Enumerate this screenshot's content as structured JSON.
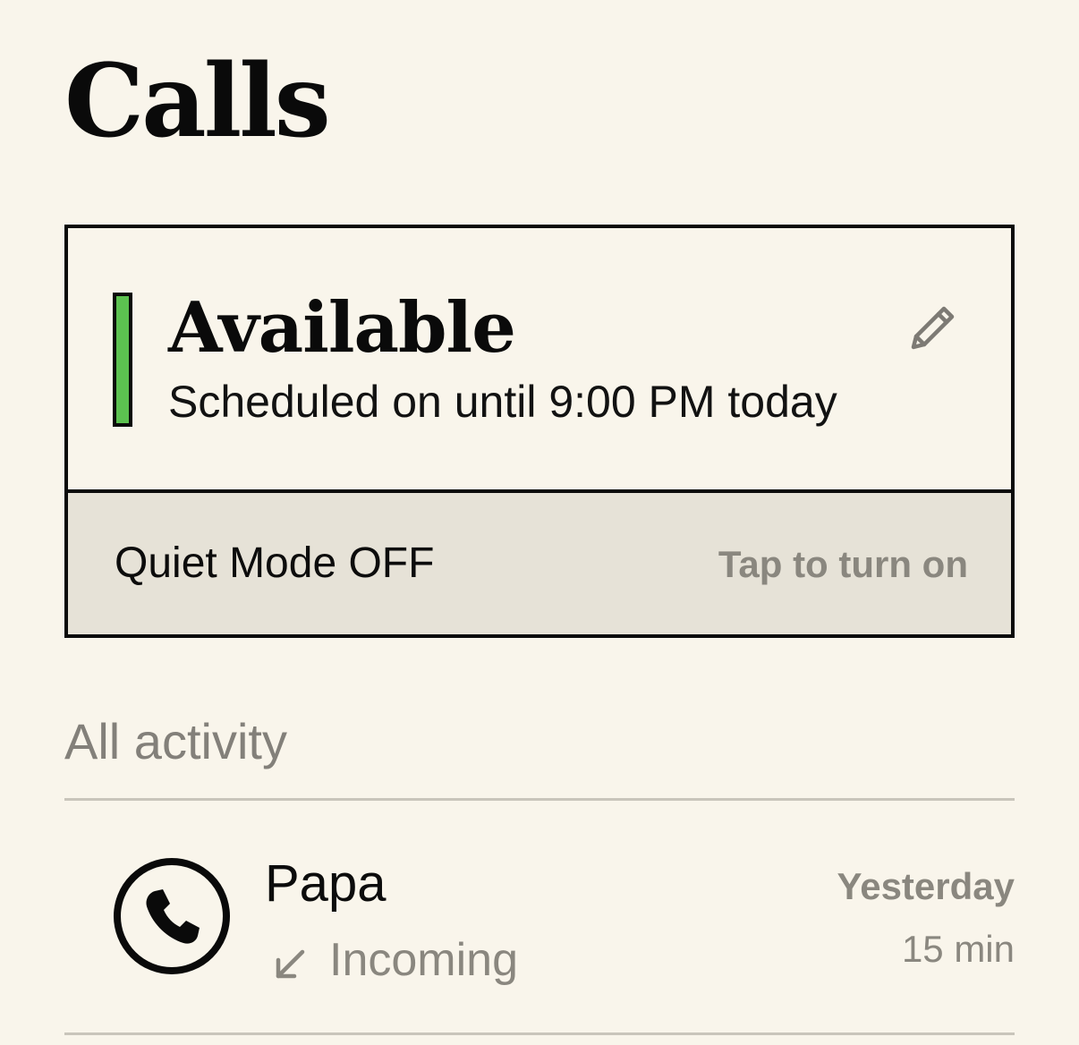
{
  "header": {
    "title": "Calls"
  },
  "status_card": {
    "status": "Available",
    "subtitle": "Scheduled on until 9:00 PM today",
    "indicator_color": "#5cc150",
    "edit_icon": "pencil-icon"
  },
  "quiet_mode": {
    "label": "Quiet Mode OFF",
    "action": "Tap to turn on"
  },
  "activity": {
    "section_title": "All activity",
    "calls": [
      {
        "name": "Papa",
        "direction": "Incoming",
        "direction_icon": "arrow-down-left-icon",
        "call_icon": "phone-icon",
        "time": "Yesterday",
        "duration": "15 min"
      }
    ]
  }
}
